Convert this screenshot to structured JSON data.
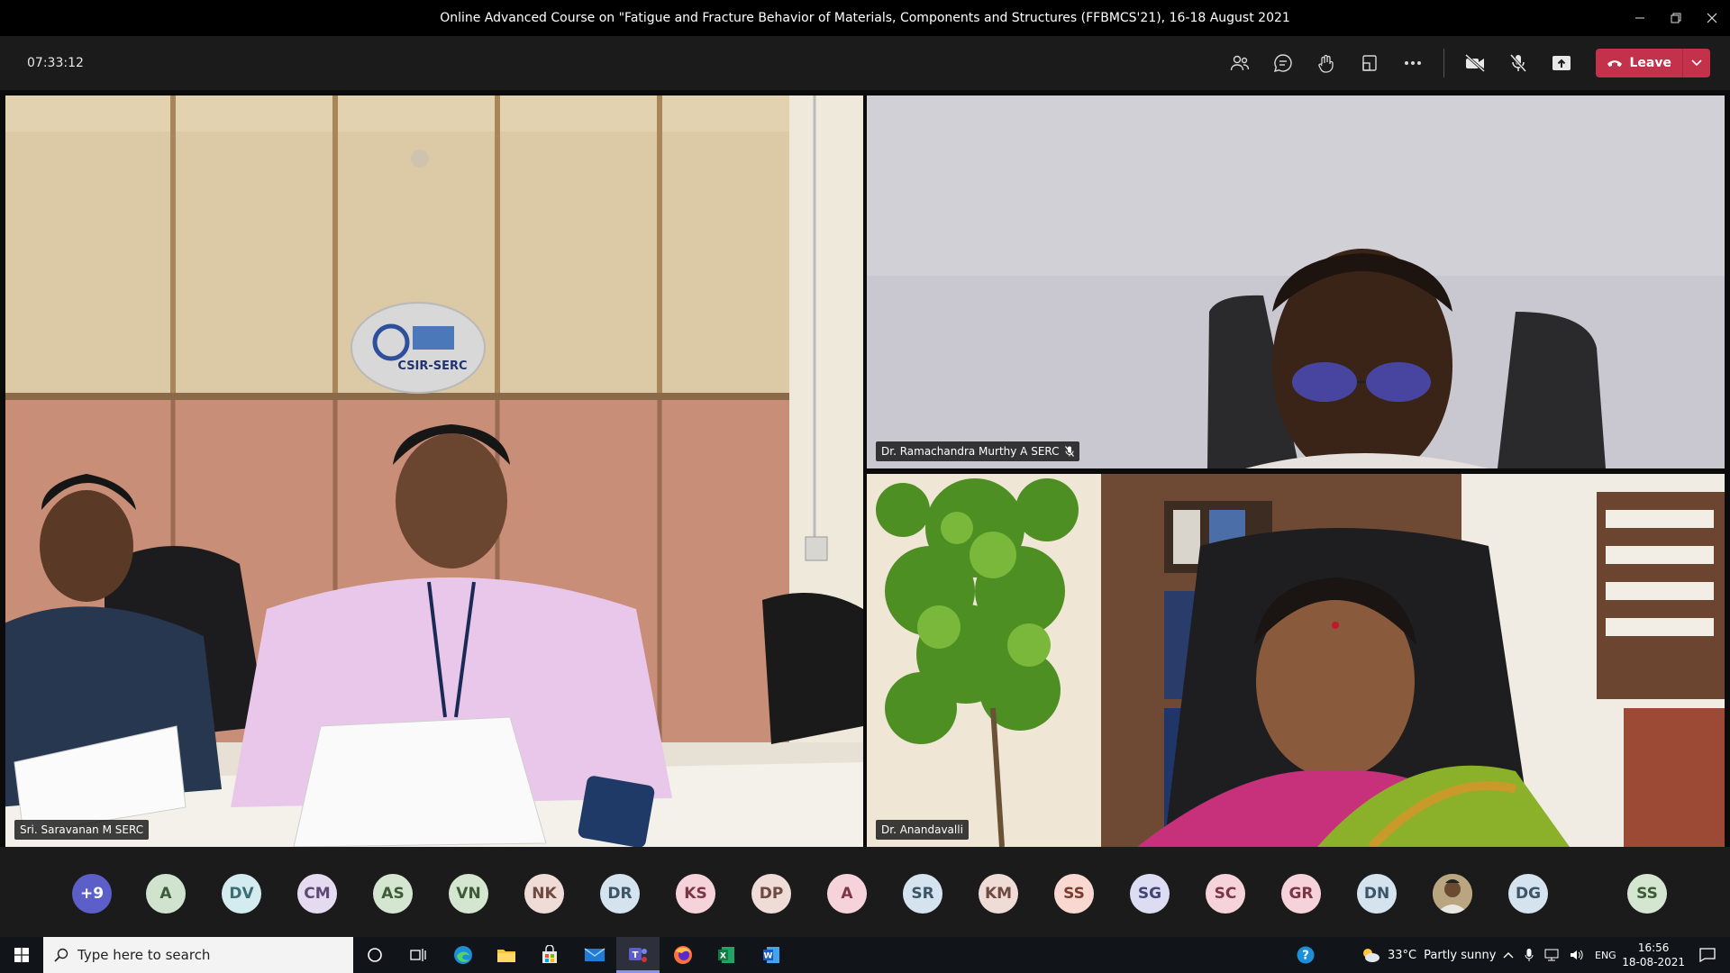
{
  "window": {
    "title": "Online Advanced Course on \"Fatigue and Fracture Behavior of Materials, Components and Structures (FFBMCS'21), 16-18 August 2021"
  },
  "meeting": {
    "timer": "07:33:12",
    "leave_label": "Leave"
  },
  "participants": {
    "tile_left": "Sri. Saravanan M SERC",
    "tile_top_right": "Dr. Ramachandra Murthy A SERC",
    "tile_bottom_right": "Dr. Anandavalli",
    "wall_logo": "CSIR-SERC"
  },
  "roster": [
    {
      "initials": "+9",
      "bg": "#5b5fc7",
      "fg": "#ffffff"
    },
    {
      "initials": "A",
      "bg": "#cfe3cf",
      "fg": "#3a5a3a"
    },
    {
      "initials": "DV",
      "bg": "#d4ecef",
      "fg": "#3d6e74"
    },
    {
      "initials": "CM",
      "bg": "#e5dbf0",
      "fg": "#5b4a74"
    },
    {
      "initials": "AS",
      "bg": "#d5e6d0",
      "fg": "#3f5a39"
    },
    {
      "initials": "VN",
      "bg": "#d5e6d0",
      "fg": "#3f5a39"
    },
    {
      "initials": "NK",
      "bg": "#efdcd6",
      "fg": "#6e4a40"
    },
    {
      "initials": "DR",
      "bg": "#d4e3ee",
      "fg": "#3c5568"
    },
    {
      "initials": "KS",
      "bg": "#f6d3da",
      "fg": "#7a3645"
    },
    {
      "initials": "DP",
      "bg": "#efdcd6",
      "fg": "#6e4a40"
    },
    {
      "initials": "A",
      "bg": "#f6d3da",
      "fg": "#7a3645"
    },
    {
      "initials": "SR",
      "bg": "#d4e3ee",
      "fg": "#3c5568"
    },
    {
      "initials": "KM",
      "bg": "#efdcd6",
      "fg": "#6e4a40"
    },
    {
      "initials": "SS",
      "bg": "#f8d8d0",
      "fg": "#7a3e2e"
    },
    {
      "initials": "SG",
      "bg": "#dcdcf3",
      "fg": "#44447a"
    },
    {
      "initials": "SC",
      "bg": "#f6d3da",
      "fg": "#7a3645"
    },
    {
      "initials": "GR",
      "bg": "#f6d3da",
      "fg": "#7a3645"
    },
    {
      "initials": "DN",
      "bg": "#d4e3ee",
      "fg": "#3c5568"
    },
    {
      "initials": "",
      "bg": "#c9b48a",
      "fg": "#3a2e1a",
      "photo": true
    },
    {
      "initials": "DG",
      "bg": "#d4e3ee",
      "fg": "#3c5568"
    },
    {
      "initials": "SS",
      "bg": "#d5e6d0",
      "fg": "#3f5a39"
    }
  ],
  "taskbar": {
    "search_placeholder": "Type here to search",
    "weather_temp": "33°C",
    "weather_text": "Partly sunny",
    "language": "ENG",
    "time": "16:56",
    "date": "18-08-2021"
  },
  "colors": {
    "leave": "#c4314b",
    "teams_accent": "#5b5fc7"
  }
}
